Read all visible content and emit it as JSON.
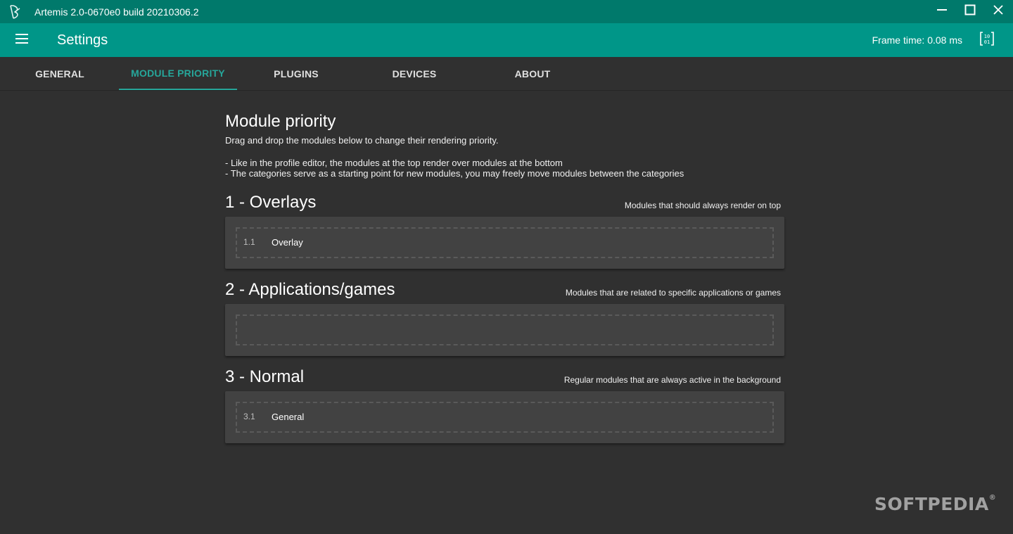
{
  "window": {
    "title": "Artemis 2.0-0670e0 build 20210306.2",
    "icons": {
      "logo": "artemis-logo-icon",
      "minimize": "minimize-icon",
      "maximize": "maximize-icon",
      "close": "close-icon"
    }
  },
  "appbar": {
    "title": "Settings",
    "frame_time": "Frame time: 0.08 ms",
    "icons": {
      "menu": "hamburger-menu-icon",
      "debug": "debugger-icon"
    }
  },
  "tabs": [
    {
      "label": "GENERAL",
      "active": false
    },
    {
      "label": "MODULE PRIORITY",
      "active": true
    },
    {
      "label": "PLUGINS",
      "active": false
    },
    {
      "label": "DEVICES",
      "active": false
    },
    {
      "label": "ABOUT",
      "active": false
    }
  ],
  "main": {
    "heading": "Module priority",
    "description": "Drag and drop the modules below to change their rendering priority.",
    "notes": [
      "- Like in the profile editor, the modules at the top render over modules at the bottom",
      "- The categories serve as a starting point for new modules, you may freely move modules between the categories"
    ],
    "categories": [
      {
        "title": "1 - Overlays",
        "description": "Modules that should always render on top",
        "modules": [
          {
            "number": "1.1",
            "name": "Overlay"
          }
        ]
      },
      {
        "title": "2 - Applications/games",
        "description": "Modules that are related to specific applications or games",
        "modules": []
      },
      {
        "title": "3 - Normal",
        "description": "Regular modules that are always active in the background",
        "modules": [
          {
            "number": "3.1",
            "name": "General"
          }
        ]
      }
    ]
  },
  "watermark": {
    "text": "SOFTPEDIA",
    "mark": "®"
  },
  "colors": {
    "titlebar": "#00796b",
    "appbar": "#009688",
    "accent": "#26a69a",
    "background": "#303030",
    "card": "#424242"
  }
}
